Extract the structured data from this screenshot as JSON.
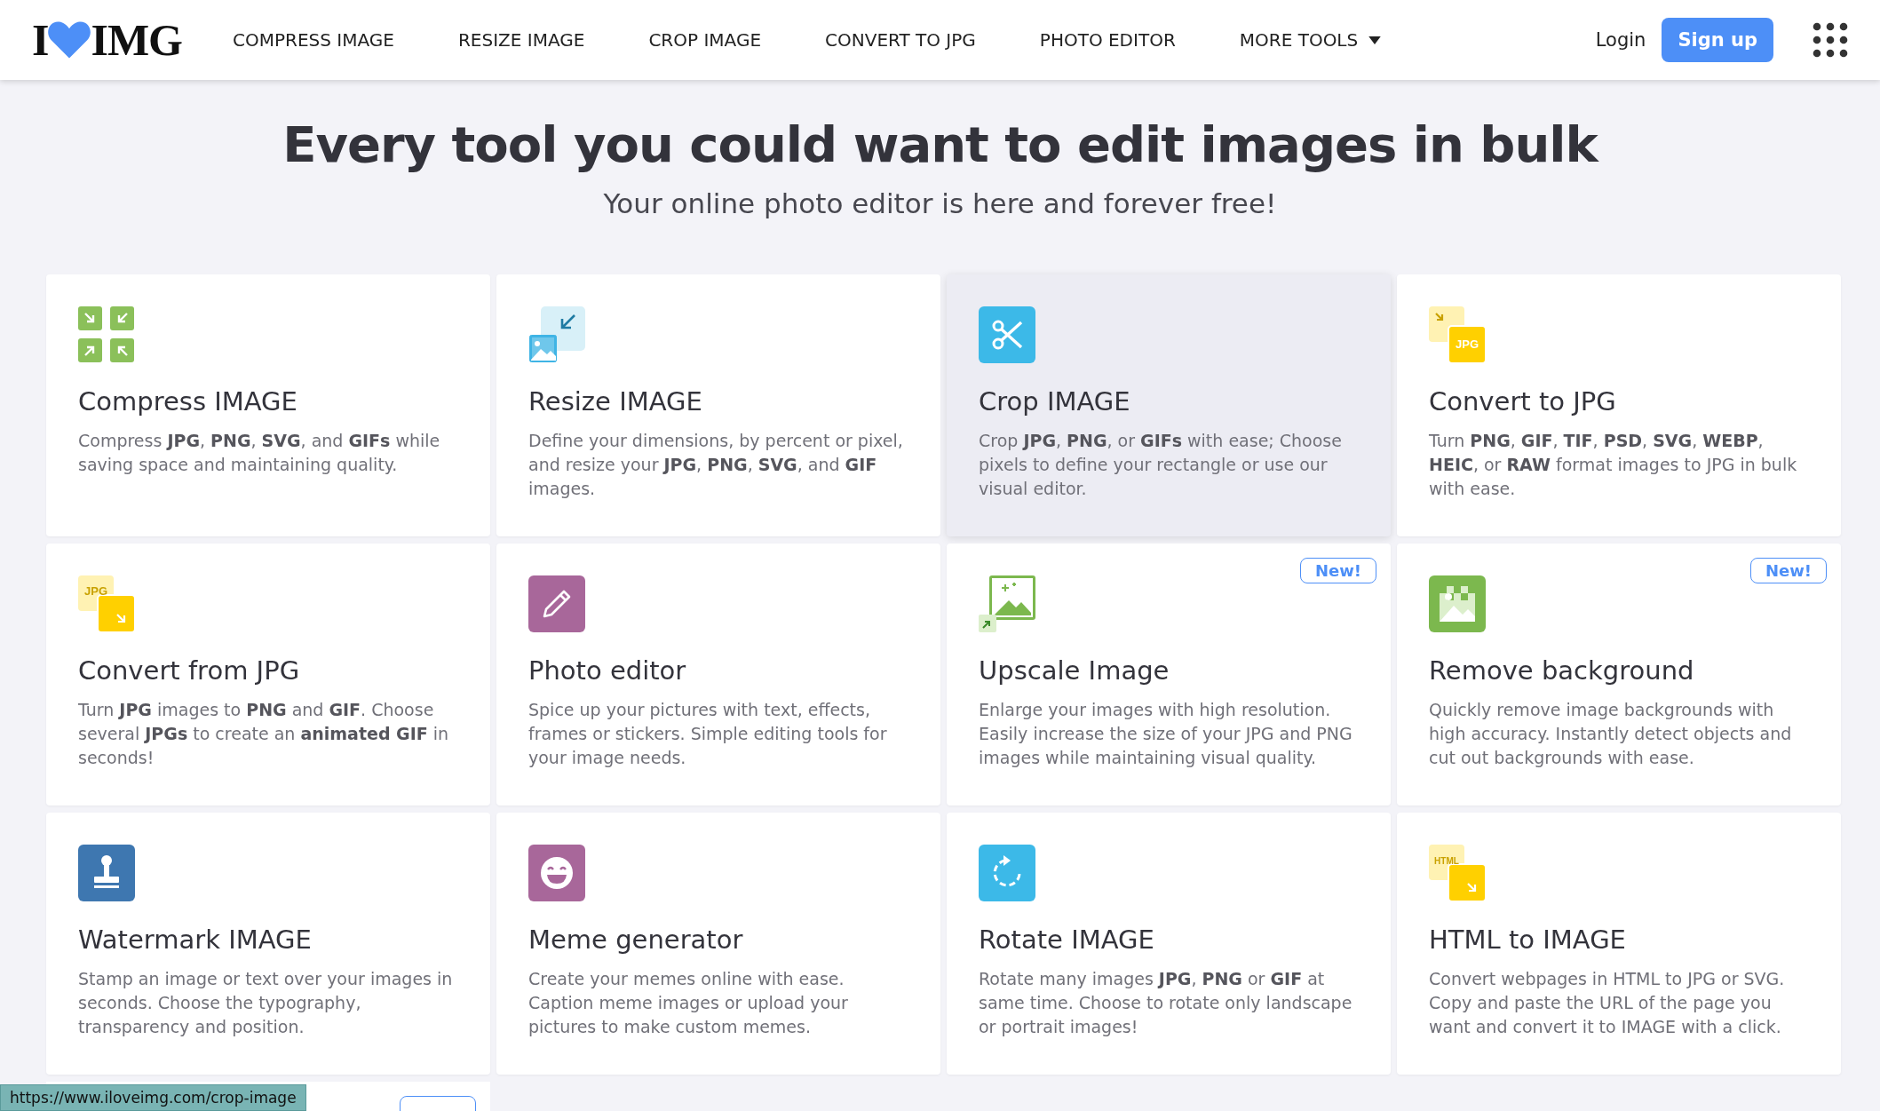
{
  "header": {
    "logo": {
      "left": "I",
      "right": "IMG"
    },
    "nav": [
      {
        "label": "COMPRESS IMAGE",
        "dropdown": false
      },
      {
        "label": "RESIZE IMAGE",
        "dropdown": false
      },
      {
        "label": "CROP IMAGE",
        "dropdown": false
      },
      {
        "label": "CONVERT TO JPG",
        "dropdown": false
      },
      {
        "label": "PHOTO EDITOR",
        "dropdown": false
      },
      {
        "label": "MORE TOOLS",
        "dropdown": true
      }
    ],
    "login": "Login",
    "signup": "Sign up"
  },
  "hero": {
    "title": "Every tool you could want to edit images in bulk",
    "subtitle": "Your online photo editor is here and forever free!"
  },
  "tools": [
    {
      "kind": "compress",
      "title": "Compress IMAGE",
      "description": "Compress **JPG**, **PNG**, **SVG**, and **GIFs** while saving space and maintaining quality.",
      "hovered": false
    },
    {
      "kind": "resize",
      "title": "Resize IMAGE",
      "description": "Define your dimensions, by percent or pixel, and resize your **JPG**, **PNG**, **SVG**, and **GIF** images.",
      "hovered": false
    },
    {
      "kind": "crop",
      "title": "Crop IMAGE",
      "description": "Crop **JPG**, **PNG**, or **GIFs** with ease; Choose pixels to define your rectangle or use our visual editor.",
      "hovered": true
    },
    {
      "kind": "to-jpg",
      "icon_text": "JPG",
      "title": "Convert to JPG",
      "description": "Turn **PNG**, **GIF**, **TIF**, **PSD**, **SVG**, **WEBP**, **HEIC**, or **RAW** format images to JPG in bulk with ease.",
      "hovered": false
    },
    {
      "kind": "from-jpg",
      "icon_text": "JPG",
      "title": "Convert from JPG",
      "description": "Turn **JPG** images to **PNG** and **GIF**. Choose several **JPGs** to create an **animated GIF** in seconds!",
      "hovered": false
    },
    {
      "kind": "editor",
      "title": "Photo editor",
      "description": "Spice up your pictures with text, effects, frames or stickers. Simple editing tools for your image needs.",
      "hovered": false
    },
    {
      "kind": "upscale",
      "title": "Upscale Image",
      "description": "Enlarge your images with high resolution. Easily increase the size of your JPG and PNG images while maintaining visual quality.",
      "badge": "New!",
      "hovered": false
    },
    {
      "kind": "remove-bg",
      "title": "Remove background",
      "description": "Quickly remove image backgrounds with high accuracy. Instantly detect objects and cut out backgrounds with ease.",
      "badge": "New!",
      "hovered": false
    },
    {
      "kind": "watermark",
      "title": "Watermark IMAGE",
      "description": "Stamp an image or text over your images in seconds. Choose the typography, transparency and position.",
      "hovered": false
    },
    {
      "kind": "meme",
      "title": "Meme generator",
      "description": "Create your memes online with ease. Caption meme images or upload your pictures to make custom memes.",
      "hovered": false
    },
    {
      "kind": "rotate",
      "title": "Rotate IMAGE",
      "description": "Rotate many images **JPG**, **PNG** or **GIF** at same time. Choose to rotate only landscape or portrait images!",
      "hovered": false
    },
    {
      "kind": "html",
      "icon_text": "HTML",
      "title": "HTML to IMAGE",
      "description": "Convert webpages in HTML to JPG or SVG. Copy and paste the URL of the page you want and convert it to IMAGE with a click.",
      "hovered": false
    }
  ],
  "status_bar": {
    "url": "https://www.iloveimg.com/crop-image"
  }
}
